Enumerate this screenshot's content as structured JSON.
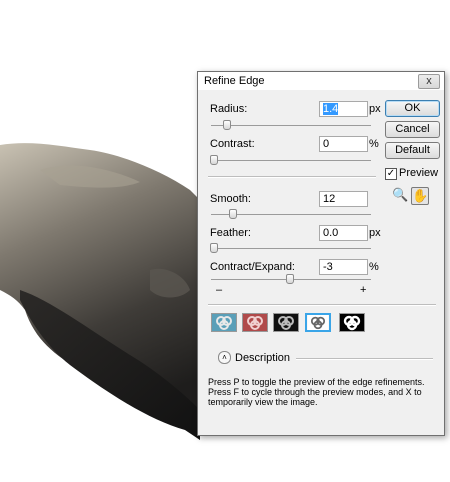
{
  "dialog": {
    "title": "Refine Edge",
    "close_glyph": "x",
    "buttons": {
      "ok": "OK",
      "cancel": "Cancel",
      "default": "Default"
    },
    "preview": {
      "label": "Preview",
      "checked": true
    },
    "tools": [
      "zoom-icon",
      "hand-icon"
    ],
    "controls": {
      "radius": {
        "label": "Radius:",
        "value": "1.4",
        "unit": "px",
        "slider": 0.08
      },
      "contrast": {
        "label": "Contrast:",
        "value": "0",
        "unit": "%",
        "slider": 0.0
      },
      "smooth": {
        "label": "Smooth:",
        "value": "12",
        "slider": 0.12
      },
      "feather": {
        "label": "Feather:",
        "value": "0.0",
        "unit": "px",
        "slider": 0.0
      },
      "contract": {
        "label": "Contract/Expand:",
        "value": "-3",
        "unit": "%",
        "slider": 0.47,
        "minus": "–",
        "plus": "+"
      }
    },
    "preview_modes": [
      "standard",
      "quick-mask",
      "on-black",
      "on-white",
      "mask"
    ],
    "active_mode": 3,
    "description": {
      "label": "Description",
      "text": "Press P to toggle the preview of the edge refinements. Press F to cycle through the preview modes, and X to temporarily view the image."
    }
  }
}
